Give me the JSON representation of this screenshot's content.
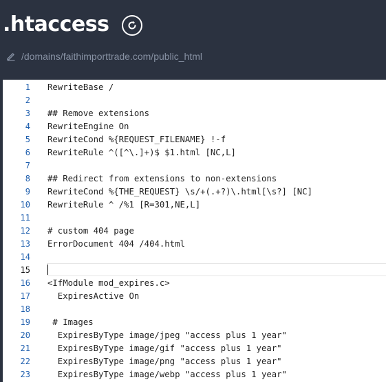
{
  "header": {
    "title": ".htaccess",
    "path": "/domains/faithimporttrade.com/public_html"
  },
  "editor": {
    "active_line": 15,
    "lines": [
      {
        "n": "1",
        "text": "RewriteBase /"
      },
      {
        "n": "2",
        "text": ""
      },
      {
        "n": "3",
        "text": "## Remove extensions"
      },
      {
        "n": "4",
        "text": "RewriteEngine On"
      },
      {
        "n": "5",
        "text": "RewriteCond %{REQUEST_FILENAME} !-f"
      },
      {
        "n": "6",
        "text": "RewriteRule ^([^\\.]+)$ $1.html [NC,L]"
      },
      {
        "n": "7",
        "text": ""
      },
      {
        "n": "8",
        "text": "## Redirect from extensions to non-extensions"
      },
      {
        "n": "9",
        "text": "RewriteCond %{THE_REQUEST} \\s/+(.+?)\\.html[\\s?] [NC]"
      },
      {
        "n": "10",
        "text": "RewriteRule ^ /%1 [R=301,NE,L]"
      },
      {
        "n": "11",
        "text": ""
      },
      {
        "n": "12",
        "text": "# custom 404 page"
      },
      {
        "n": "13",
        "text": "ErrorDocument 404 /404.html"
      },
      {
        "n": "14",
        "text": ""
      },
      {
        "n": "15",
        "text": ""
      },
      {
        "n": "16",
        "text": "<IfModule mod_expires.c>"
      },
      {
        "n": "17",
        "text": "  ExpiresActive On"
      },
      {
        "n": "18",
        "text": ""
      },
      {
        "n": "19",
        "text": " # Images"
      },
      {
        "n": "20",
        "text": "  ExpiresByType image/jpeg \"access plus 1 year\""
      },
      {
        "n": "21",
        "text": "  ExpiresByType image/gif \"access plus 1 year\""
      },
      {
        "n": "22",
        "text": "  ExpiresByType image/png \"access plus 1 year\""
      },
      {
        "n": "23",
        "text": "  ExpiresByType image/webp \"access plus 1 year\""
      }
    ]
  },
  "colors": {
    "header_bg": "#2b3240",
    "line_number": "#1f5fae",
    "path_text": "#8791a3"
  },
  "icons": {
    "refresh": "refresh-icon",
    "edit": "pencil-icon"
  }
}
